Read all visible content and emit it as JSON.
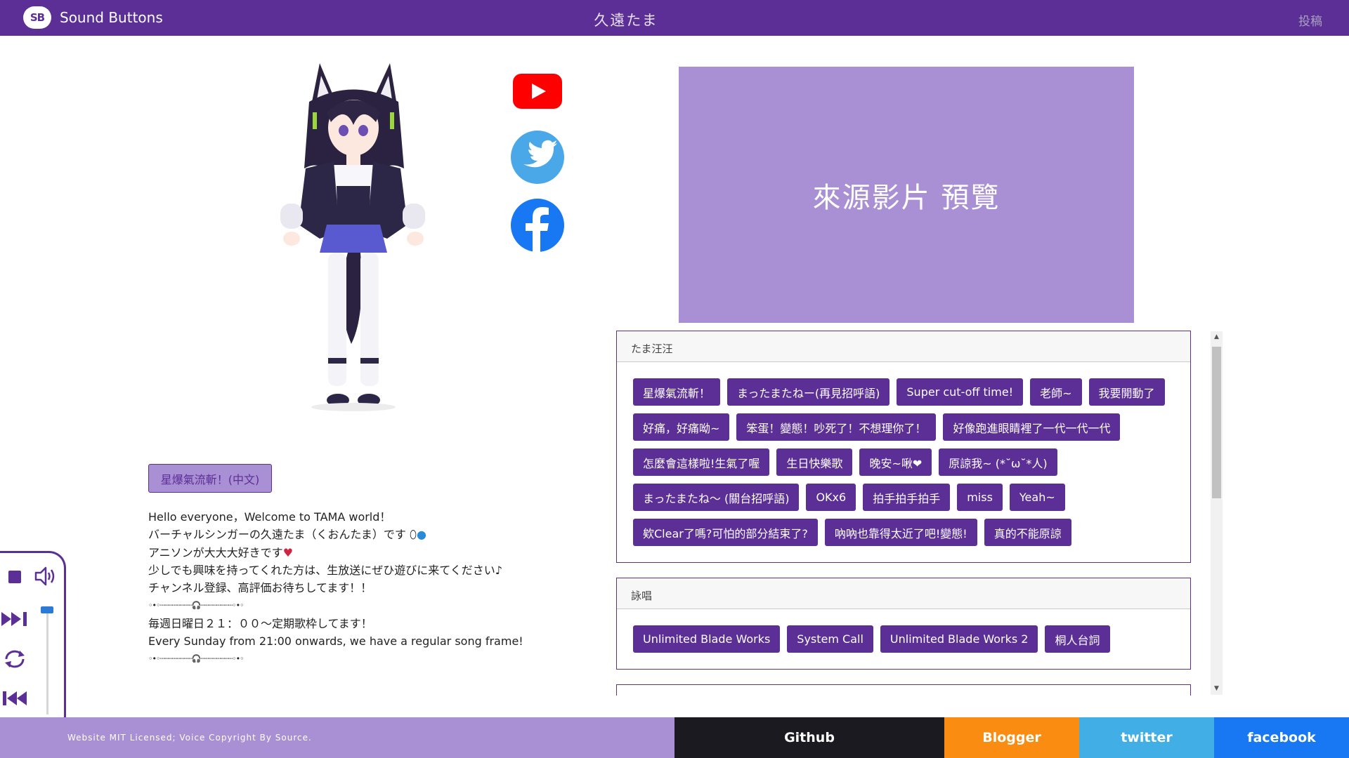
{
  "header": {
    "brand": "Sound Buttons",
    "logo_text": "SB",
    "title": "久遠たま",
    "post_link": "投稿"
  },
  "social": {
    "icons": [
      "youtube-icon",
      "twitter-icon",
      "facebook-icon"
    ],
    "colors": {
      "youtube": "#ff0000",
      "twitter": "#4aa8e8",
      "facebook": "#1877f2"
    }
  },
  "preview": {
    "label": "來源影片 預覽"
  },
  "language_button": "星爆氣流斬！(中文)",
  "description": {
    "lines": [
      "Hello everyone，Welcome to TAMA world！",
      "バーチャルシンガーの久遠たま（くおんたま）です",
      "アニソンが大大大好きです",
      "少しでも興味を持ってくれた方は、生放送にぜひ遊びに来てください♪",
      "チャンネル登録、高評価お待ちしてます！！",
      "◦•◦┈┈┈┈┈┈┈┈🎧┈┈┈┈┈┈┈┈◦•◦",
      "毎週日曜日２１：００～定期歌枠してます！",
      "Every Sunday from 21:00 onwards, we have a regular song frame!",
      "◦•◦┈┈┈┈┈┈┈┈🎧┈┈┈┈┈┈┈┈◦•◦"
    ]
  },
  "player": {
    "icons": [
      "stop-icon",
      "volume-icon",
      "next-icon",
      "loop-icon",
      "previous-icon"
    ],
    "volume": 1.0
  },
  "categories": [
    {
      "name": "たま汪汪",
      "buttons": [
        "星爆氣流斬！",
        "まったまたねー(再見招呼語)",
        "Super cut-off time!",
        "老師~",
        "我要開動了",
        "好痛，好痛呦~",
        "笨蛋！變態！吵死了！不想理你了！",
        "好像跑進眼睛裡了一代一代一代",
        "怎麼會這樣啦!生氣了喔",
        "生日快樂歌",
        "晚安~啾❤",
        "原諒我~ (*˘ω˘*人)",
        "まったまたね～ (關台招呼語)",
        "OKx6",
        "拍手拍手拍手",
        "miss",
        "Yeah~",
        "欸Clear了嗎?可怕的部分結束了?",
        "吶吶也靠得太近了吧!變態!",
        "真的不能原諒"
      ]
    },
    {
      "name": "詠唱",
      "buttons": [
        "Unlimited Blade Works",
        "System Call",
        "Unlimited Blade Works 2",
        "桐人台詞"
      ]
    }
  ],
  "footer": {
    "license": "Website MIT Licensed; Voice Copyright By Source.",
    "links": [
      "Github",
      "Blogger",
      "twitter",
      "facebook"
    ],
    "colors": {
      "license_bg": "#a98fd4",
      "github": "#1c1a21",
      "blogger": "#fb8c12",
      "twitter": "#41aee6",
      "facebook": "#1877f2"
    }
  }
}
